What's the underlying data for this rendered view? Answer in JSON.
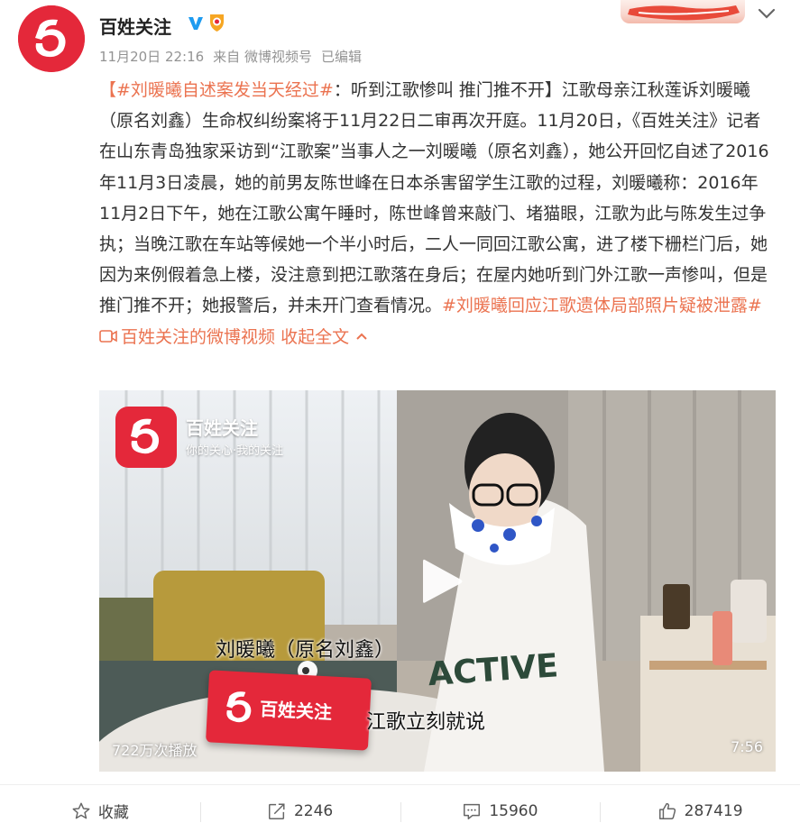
{
  "author": {
    "name": "百姓关注",
    "verified_icon": "verified-v-icon",
    "gold_badge_icon": "gold-badge-icon"
  },
  "meta": {
    "date": "11月20日 22:16",
    "source": "来自 微博视频号",
    "edited": "已编辑"
  },
  "post": {
    "topic1": "【#刘暖曦自述案发当天经过#",
    "seg1": "：听到江歌惨叫 推门推不开】江歌母亲江秋莲诉刘暖曦 （原名刘鑫）生命权纠纷案将于11月22日二审再次开庭。11月20日，《百姓关注》记者在山东青岛独家采访到“江歌案”当事人之一刘暖曦（原名刘鑫），她公开回忆自述了2016年11月3日凌晨，她的前男友陈世峰在日本杀害留学生江歌的过程，刘暖曦称：2016年11月2日下午，她在江歌公寓午睡时，陈世峰曾来敲门、堵猫眼，江歌为此与陈发生过争执；当晚江歌在车站等候她一个半小时后，二人一同回江歌公寓，进了楼下栅栏门后，她因为来例假着急上楼，没注意到把江歌落在身后；在屋内她听到门外江歌一声惨叫，但是推门推不开；她报警后，并未开门查看情况。",
    "topic2": "#刘暖曦回应江歌遗体局部照片疑被泄露#",
    "video_link": "百姓关注的微博视频",
    "collapse": "收起全文"
  },
  "video": {
    "watermark_title": "百姓关注",
    "watermark_sub": "你的关心·我的关注",
    "caption_name": "刘暖曦（原名刘鑫）",
    "caption_quote": "江歌立刻就说",
    "mic_label": "百姓关注",
    "plays": "722万次播放",
    "duration": "7:56"
  },
  "actions": {
    "favorite": "收藏",
    "reposts": "2246",
    "comments": "15960",
    "likes": "287419"
  },
  "colors": {
    "link": "#eb7350",
    "brand_red": "#e4283a"
  }
}
